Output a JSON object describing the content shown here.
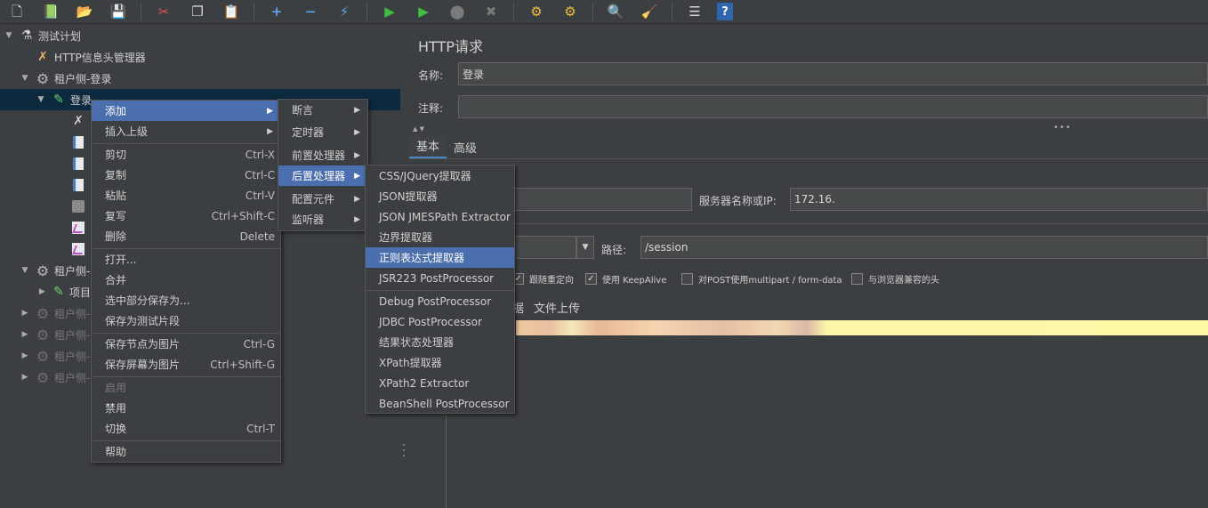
{
  "toolbar": {
    "buttons": [
      {
        "name": "new-icon",
        "glyph": "🗋"
      },
      {
        "name": "templates-icon",
        "glyph": "📗"
      },
      {
        "name": "open-icon",
        "glyph": "📂"
      },
      {
        "name": "save-icon",
        "glyph": "💾"
      },
      {
        "name": "cut-icon",
        "glyph": "✂"
      },
      {
        "name": "copy-icon",
        "glyph": "❐"
      },
      {
        "name": "paste-icon",
        "glyph": "📋"
      },
      {
        "name": "expand-icon",
        "glyph": "+"
      },
      {
        "name": "collapse-icon",
        "glyph": "−"
      },
      {
        "name": "toggle-icon",
        "glyph": "⚡"
      },
      {
        "name": "start-icon",
        "glyph": "▶"
      },
      {
        "name": "start-no-pause-icon",
        "glyph": "▶"
      },
      {
        "name": "stop-icon",
        "glyph": "⬤"
      },
      {
        "name": "shutdown-icon",
        "glyph": "✖"
      },
      {
        "name": "clear-icon",
        "glyph": "⚙"
      },
      {
        "name": "clear-all-icon",
        "glyph": "⚙"
      },
      {
        "name": "search-icon",
        "glyph": "🔍"
      },
      {
        "name": "reset-search-icon",
        "glyph": "🧹"
      },
      {
        "name": "function-helper-icon",
        "glyph": "☰"
      },
      {
        "name": "help-icon",
        "glyph": "?"
      }
    ]
  },
  "tree": {
    "test_plan": "测试计划",
    "header_manager": "HTTP信息头管理器",
    "thread_group_login": "租户侧-登录",
    "login_sampler": "登录",
    "thread_group_2": "租户侧-",
    "project_item": "项目",
    "thread_group_3": "租户侧-",
    "thread_group_4": "租户侧-",
    "thread_group_5": "租户侧-",
    "thread_group_6": "租户侧-"
  },
  "panel": {
    "title": "HTTP请求",
    "name_label": "名称:",
    "name_value": "登录",
    "comment_label": "注释:",
    "comment_value": "",
    "tabs": [
      "基本",
      "高级"
    ],
    "server_label": "服务器名称或IP:",
    "server_value": "172.16.",
    "path_label": "路径:",
    "path_value": "/session",
    "checkboxes": [
      {
        "label": "跟随重定向",
        "checked": true
      },
      {
        "label": "使用 KeepAlive",
        "checked": true
      },
      {
        "label": "对POST使用multipart / form-data",
        "checked": false
      },
      {
        "label": "与浏览器兼容的头",
        "checked": false
      }
    ],
    "subtab_partial": "据",
    "subtab_file_upload": "文件上传"
  },
  "context_menu": {
    "items": [
      {
        "label": "添加",
        "submenu": true,
        "highlighted": true
      },
      {
        "label": "插入上级",
        "submenu": true
      },
      {
        "sep": true
      },
      {
        "label": "剪切",
        "accel": "Ctrl-X"
      },
      {
        "label": "复制",
        "accel": "Ctrl-C"
      },
      {
        "label": "粘贴",
        "accel": "Ctrl-V"
      },
      {
        "label": "复写",
        "accel": "Ctrl+Shift-C"
      },
      {
        "label": "删除",
        "accel": "Delete"
      },
      {
        "sep": true
      },
      {
        "label": "打开..."
      },
      {
        "label": "合并"
      },
      {
        "label": "选中部分保存为..."
      },
      {
        "label": "保存为测试片段"
      },
      {
        "sep": true
      },
      {
        "label": "保存节点为图片",
        "accel": "Ctrl-G"
      },
      {
        "label": "保存屏幕为图片",
        "accel": "Ctrl+Shift-G"
      },
      {
        "sep": true
      },
      {
        "label": "启用",
        "disabled": true
      },
      {
        "label": "禁用"
      },
      {
        "label": "切换",
        "accel": "Ctrl-T"
      },
      {
        "sep": true
      },
      {
        "label": "帮助"
      }
    ]
  },
  "add_submenu": {
    "items": [
      {
        "label": "断言"
      },
      {
        "label": "定时器"
      },
      {
        "label": "前置处理器"
      },
      {
        "label": "后置处理器",
        "highlighted": true
      },
      {
        "label": "配置元件"
      },
      {
        "label": "监听器"
      }
    ]
  },
  "post_processor_menu": {
    "items": [
      {
        "label": "CSS/JQuery提取器"
      },
      {
        "label": "JSON提取器"
      },
      {
        "label": "JSON JMESPath Extractor"
      },
      {
        "label": "边界提取器"
      },
      {
        "label": "正则表达式提取器",
        "highlighted": true
      },
      {
        "label": "JSR223 PostProcessor"
      },
      {
        "sep": true
      },
      {
        "label": "Debug PostProcessor"
      },
      {
        "label": "JDBC PostProcessor"
      },
      {
        "label": "结果状态处理器"
      },
      {
        "label": "XPath提取器"
      },
      {
        "label": "XPath2 Extractor"
      },
      {
        "label": "BeanShell PostProcessor"
      }
    ]
  }
}
